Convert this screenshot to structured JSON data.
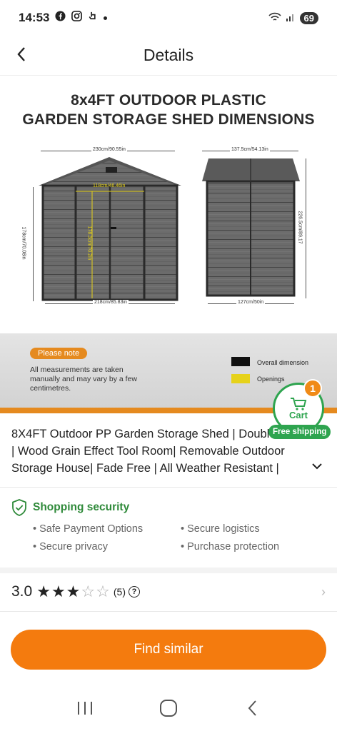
{
  "status_bar": {
    "time": "14:53",
    "battery": "69"
  },
  "header": {
    "title": "Details"
  },
  "product_image": {
    "title_line1": "8x4FT OUTDOOR PLASTIC",
    "title_line2": "GARDEN STORAGE SHED DIMENSIONS",
    "dim_front_width": "230cm/90.55in",
    "dim_door_width": "118cm/46.46in",
    "dim_height": "178cm/70.08in",
    "dim_door_height": "178.3cm/70.2in",
    "dim_base_width": "218cm/85.83in",
    "dim_side_width": "137.5cm/54.13in",
    "dim_side_height": "226.5cm/89.17",
    "dim_side_base": "127cm/50in",
    "note_badge": "Please note",
    "note_text": "All measurements are taken manually and may vary by a few centimetres.",
    "legend": [
      {
        "label": "Overall dimension",
        "color": "#111111"
      },
      {
        "label": "Openings",
        "color": "#e6d21a"
      }
    ]
  },
  "cart": {
    "label": "Cart",
    "count": "1",
    "free_shipping": "Free shipping"
  },
  "product": {
    "title": "8X4FT Outdoor PP Garden Storage Shed | Double Door | Wood Grain Effect Tool Room| Removable Outdoor Storage House| Fade Free | All Weather Resistant |"
  },
  "security": {
    "title": "Shopping security",
    "items": [
      "Safe Payment Options",
      "Secure logistics",
      "Secure privacy",
      "Purchase protection"
    ]
  },
  "rating": {
    "value": "3.0",
    "stars": 3,
    "max_stars": 5,
    "count": "(5)"
  },
  "actions": {
    "find_similar": "Find similar"
  }
}
